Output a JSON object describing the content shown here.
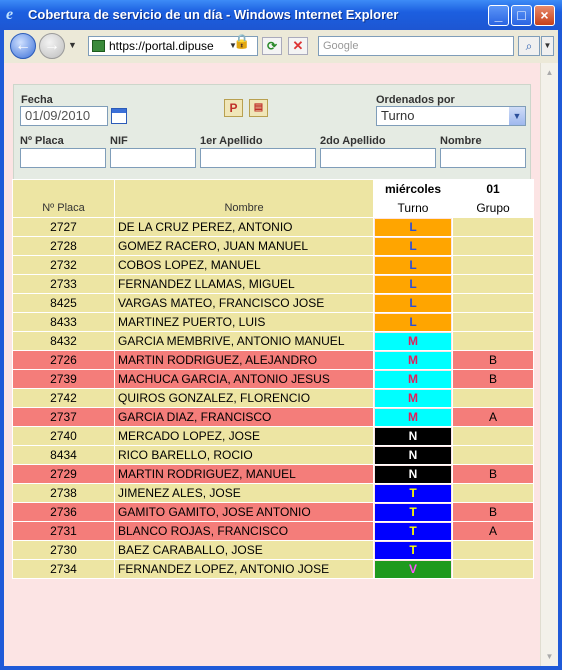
{
  "window": {
    "title": "Cobertura de servicio de un día - Windows Internet Explorer",
    "address": "https://portal.dipuse",
    "search_placeholder": "Google"
  },
  "form": {
    "fecha_label": "Fecha",
    "fecha_value": "01/09/2010",
    "ordenados_label": "Ordenados por",
    "ordenados_value": "Turno",
    "placa_label": "Nº Placa",
    "nif_label": "NIF",
    "apellido1_label": "1er Apellido",
    "apellido2_label": "2do Apellido",
    "nombre_label": "Nombre",
    "print_button_label": "P"
  },
  "table": {
    "col_placa": "Nº Placa",
    "col_nombre": "Nombre",
    "day_name": "miércoles",
    "day_number": "01",
    "col_turno": "Turno",
    "col_grupo": "Grupo",
    "rows": [
      {
        "placa": "2727",
        "nombre": "DE LA CRUZ  PEREZ, ANTONIO",
        "turno": "L",
        "grupo": "",
        "highlight": false
      },
      {
        "placa": "2728",
        "nombre": "GOMEZ  RACERO, JUAN MANUEL",
        "turno": "L",
        "grupo": "",
        "highlight": false
      },
      {
        "placa": "2732",
        "nombre": "COBOS  LOPEZ, MANUEL",
        "turno": "L",
        "grupo": "",
        "highlight": false
      },
      {
        "placa": "2733",
        "nombre": "FERNANDEZ  LLAMAS, MIGUEL",
        "turno": "L",
        "grupo": "",
        "highlight": false
      },
      {
        "placa": "8425",
        "nombre": "VARGAS  MATEO, FRANCISCO JOSE",
        "turno": "L",
        "grupo": "",
        "highlight": false
      },
      {
        "placa": "8433",
        "nombre": "MARTINEZ  PUERTO, LUIS",
        "turno": "L",
        "grupo": "",
        "highlight": false
      },
      {
        "placa": "8432",
        "nombre": "GARCIA  MEMBRIVE, ANTONIO MANUEL",
        "turno": "M",
        "grupo": "",
        "highlight": false
      },
      {
        "placa": "2726",
        "nombre": "MARTIN  RODRIGUEZ, ALEJANDRO",
        "turno": "M",
        "grupo": "B",
        "highlight": true
      },
      {
        "placa": "2739",
        "nombre": "MACHUCA  GARCIA, ANTONIO JESUS",
        "turno": "M",
        "grupo": "B",
        "highlight": true
      },
      {
        "placa": "2742",
        "nombre": "QUIROS  GONZALEZ, FLORENCIO",
        "turno": "M",
        "grupo": "",
        "highlight": false
      },
      {
        "placa": "2737",
        "nombre": "GARCIA  DIAZ, FRANCISCO",
        "turno": "M",
        "grupo": "A",
        "highlight": true
      },
      {
        "placa": "2740",
        "nombre": "MERCADO  LOPEZ, JOSE",
        "turno": "N",
        "grupo": "",
        "highlight": false
      },
      {
        "placa": "8434",
        "nombre": "RICO  BARELLO, ROCIO",
        "turno": "N",
        "grupo": "",
        "highlight": false
      },
      {
        "placa": "2729",
        "nombre": "MARTIN  RODRIGUEZ, MANUEL",
        "turno": "N",
        "grupo": "B",
        "highlight": true
      },
      {
        "placa": "2738",
        "nombre": "JIMENEZ  ALES, JOSE",
        "turno": "T",
        "grupo": "",
        "highlight": false
      },
      {
        "placa": "2736",
        "nombre": "GAMITO  GAMITO, JOSE ANTONIO",
        "turno": "T",
        "grupo": "B",
        "highlight": true
      },
      {
        "placa": "2731",
        "nombre": "BLANCO  ROJAS, FRANCISCO",
        "turno": "T",
        "grupo": "A",
        "highlight": true
      },
      {
        "placa": "2730",
        "nombre": "BAEZ  CARABALLO, JOSE",
        "turno": "T",
        "grupo": "",
        "highlight": false
      },
      {
        "placa": "2734",
        "nombre": "FERNANDEZ  LOPEZ, ANTONIO JOSE",
        "turno": "V",
        "grupo": "",
        "highlight": false
      }
    ]
  },
  "shift_colors": {
    "L": {
      "bg": "#ffa500",
      "fg": "#2b4fd6"
    },
    "M": {
      "bg": "#00ffff",
      "fg": "#e0205c"
    },
    "N": {
      "bg": "#000000",
      "fg": "#ffffff"
    },
    "T": {
      "bg": "#0000ff",
      "fg": "#ffff00"
    },
    "V": {
      "bg": "#1e9a1e",
      "fg": "#ff55ff"
    }
  }
}
